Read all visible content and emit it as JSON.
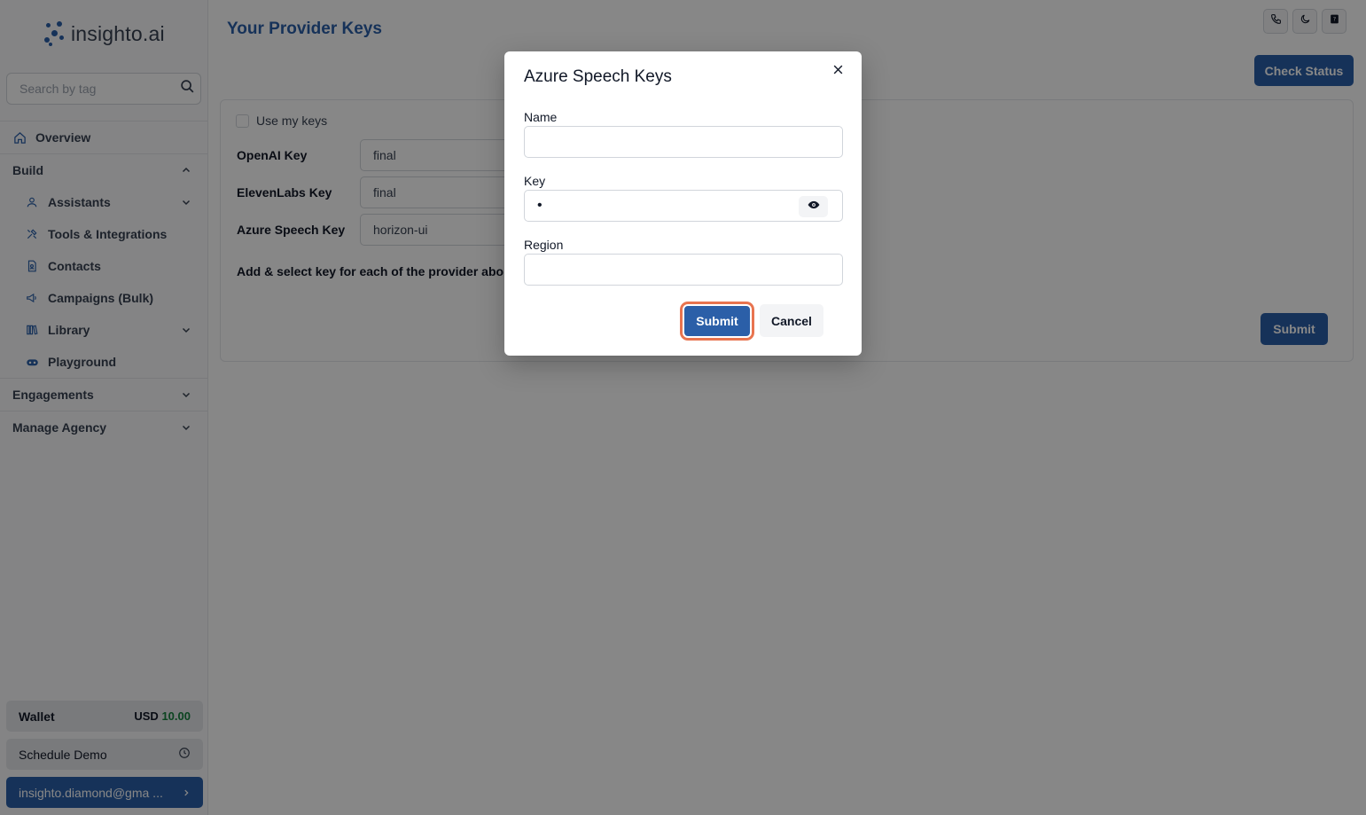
{
  "brand": {
    "name": "insighto.ai"
  },
  "sidebar": {
    "search_placeholder": "Search by tag",
    "overview": "Overview",
    "build": "Build",
    "build_items": [
      {
        "label": "Assistants",
        "icon": "user-icon"
      },
      {
        "label": "Tools & Integrations",
        "icon": "tools-icon"
      },
      {
        "label": "Contacts",
        "icon": "contacts-icon"
      },
      {
        "label": "Campaigns (Bulk)",
        "icon": "megaphone-icon"
      },
      {
        "label": "Library",
        "icon": "library-icon"
      },
      {
        "label": "Playground",
        "icon": "gamepad-icon"
      }
    ],
    "engagements": "Engagements",
    "manage_agency": "Manage Agency",
    "wallet_label": "Wallet",
    "wallet_currency": "USD",
    "wallet_amount": "10.00",
    "schedule_demo": "Schedule Demo",
    "user_email": "insighto.diamond@gma ..."
  },
  "main": {
    "title": "Your Provider Keys",
    "check_status": "Check Status",
    "use_my_keys": "Use my keys",
    "keys": [
      {
        "label": "OpenAI Key",
        "value": "final"
      },
      {
        "label": "ElevenLabs Key",
        "value": "final"
      },
      {
        "label": "Azure Speech Key",
        "value": "horizon-ui"
      }
    ],
    "hint": "Add & select key for each of the provider abo",
    "submit": "Submit"
  },
  "modal": {
    "title": "Azure Speech Keys",
    "name_label": "Name",
    "name_value": "",
    "key_label": "Key",
    "key_value": "•",
    "region_label": "Region",
    "region_value": "",
    "submit": "Submit",
    "cancel": "Cancel"
  },
  "colors": {
    "primary": "#2b5fa8",
    "focus_ring": "#e8744f",
    "wallet_amount": "#15803d"
  }
}
